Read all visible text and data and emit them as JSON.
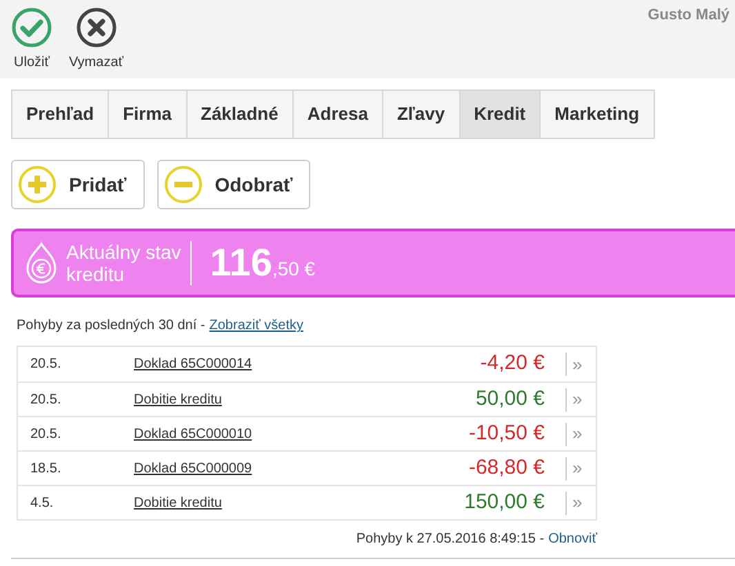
{
  "toolbar": {
    "actions": [
      {
        "kind": "save",
        "label": "Uložiť"
      },
      {
        "kind": "delete",
        "label": "Vymazať"
      }
    ],
    "user": "Gusto Malý"
  },
  "tabs": [
    {
      "label": "Prehľad",
      "selected": false
    },
    {
      "label": "Firma",
      "selected": false
    },
    {
      "label": "Základné",
      "selected": false
    },
    {
      "label": "Adresa",
      "selected": false
    },
    {
      "label": "Zľavy",
      "selected": false
    },
    {
      "label": "Kredit",
      "selected": true
    },
    {
      "label": "Marketing",
      "selected": false
    }
  ],
  "buttons": [
    {
      "kind": "add",
      "label": "Pridať"
    },
    {
      "kind": "remove",
      "label": "Odobrať"
    }
  ],
  "balance": {
    "label_line1": "Aktuálny stav",
    "label_line2": "kreditu",
    "whole": "116",
    "fraction": ",50 €"
  },
  "movements": {
    "intro": "Pohyby za posledných 30 dní -",
    "show_all": "Zobraziť všetky",
    "rows": [
      {
        "date": "20.5.",
        "document": "Doklad 65C000014",
        "amount": "-4,20 €",
        "kind": "debit",
        "more": "»"
      },
      {
        "date": "20.5.",
        "document": "Dobitie kreditu",
        "amount": "50,00 €",
        "kind": "credit",
        "more": "»"
      },
      {
        "date": "20.5.",
        "document": "Doklad 65C000010",
        "amount": "-10,50 €",
        "kind": "debit",
        "more": "»"
      },
      {
        "date": "18.5.",
        "document": "Doklad 65C000009",
        "amount": "-68,80 €",
        "kind": "debit",
        "more": "»"
      },
      {
        "date": "4.5.",
        "document": "Dobitie kreditu",
        "amount": "150,00 €",
        "kind": "credit",
        "more": "»"
      }
    ],
    "footer": "Pohyby k 27.05.2016 8:49:15 -",
    "refresh": "Obnoviť"
  }
}
